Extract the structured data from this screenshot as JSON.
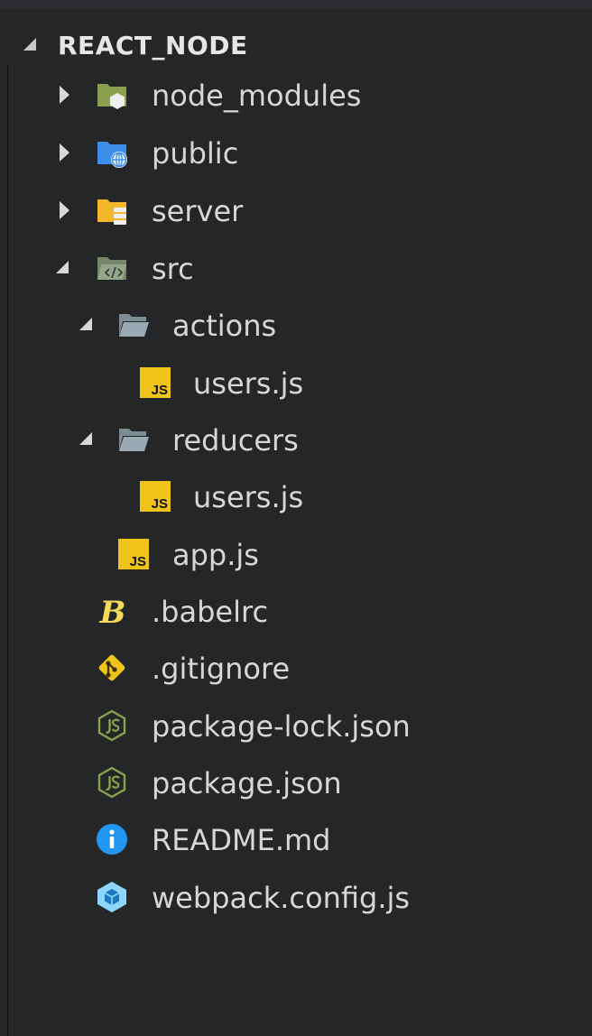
{
  "explorer": {
    "section_title": "REACT_NODE",
    "items": [
      {
        "label": "node_modules",
        "icon": "node-folder-icon",
        "kind": "folder",
        "state": "collapsed"
      },
      {
        "label": "public",
        "icon": "public-folder-icon",
        "kind": "folder",
        "state": "collapsed"
      },
      {
        "label": "server",
        "icon": "server-folder-icon",
        "kind": "folder",
        "state": "collapsed"
      },
      {
        "label": "src",
        "icon": "src-folder-icon",
        "kind": "folder",
        "state": "expanded"
      },
      {
        "label": "actions",
        "icon": "folder-open-icon",
        "kind": "folder",
        "state": "expanded"
      },
      {
        "label": "users.js",
        "icon": "javascript-file-icon",
        "kind": "file"
      },
      {
        "label": "reducers",
        "icon": "folder-open-icon",
        "kind": "folder",
        "state": "expanded"
      },
      {
        "label": "users.js",
        "icon": "javascript-file-icon",
        "kind": "file"
      },
      {
        "label": "app.js",
        "icon": "javascript-file-icon",
        "kind": "file"
      },
      {
        "label": ".babelrc",
        "icon": "babel-icon",
        "kind": "file"
      },
      {
        "label": ".gitignore",
        "icon": "git-icon",
        "kind": "file"
      },
      {
        "label": "package-lock.json",
        "icon": "nodejs-icon",
        "kind": "file"
      },
      {
        "label": "package.json",
        "icon": "nodejs-icon",
        "kind": "file"
      },
      {
        "label": "README.md",
        "icon": "info-icon",
        "kind": "file"
      },
      {
        "label": "webpack.config.js",
        "icon": "webpack-icon",
        "kind": "file"
      }
    ],
    "icon_text": {
      "js": "JS",
      "babel": "B"
    }
  },
  "colors": {
    "background": "#252628",
    "text": "#d7d7d7",
    "js_yellow": "#f0c419",
    "folder_blue": "#3d8ee8",
    "folder_yellow": "#f3b72a",
    "folder_gray": "#7d8c95",
    "node_green": "#8aa04e",
    "info_blue": "#2196f3",
    "webpack_blue": "#8ed6fb"
  }
}
